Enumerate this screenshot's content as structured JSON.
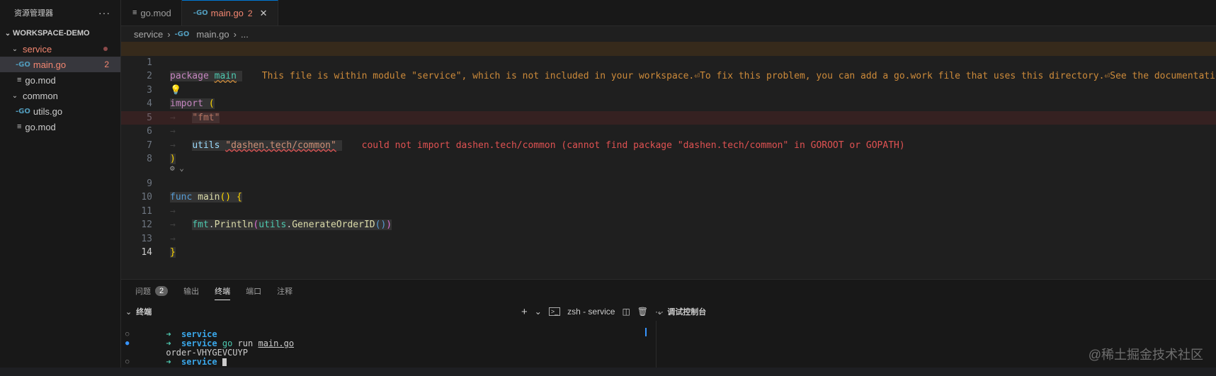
{
  "sidebar": {
    "title": "资源管理器",
    "more": "···",
    "workspace": "WORKSPACE-DEMO",
    "items": [
      {
        "label": "service",
        "type": "folder"
      },
      {
        "label": "main.go",
        "type": "go",
        "count": "2"
      },
      {
        "label": "go.mod",
        "type": "mod"
      },
      {
        "label": "common",
        "type": "folder"
      },
      {
        "label": "utils.go",
        "type": "go"
      },
      {
        "label": "go.mod",
        "type": "mod"
      }
    ]
  },
  "tabs": [
    {
      "label": "go.mod"
    },
    {
      "label": "main.go",
      "badge": "2"
    }
  ],
  "breadcrumb": {
    "folder": "service",
    "file": "main.go",
    "more": "..."
  },
  "warning_message": "This file is within module \"service\", which is not included in your workspace.⏎To fix this problem, you can add a go.work file that uses this directory.⏎See the documentatio",
  "error_message": "could not import dashen.tech/common (cannot find package \"dashen.tech/common\" in GOROOT or GOPATH)",
  "code": {
    "package_kw": "package",
    "package_name": "main",
    "import_kw": "import",
    "fmt_str": "\"fmt\"",
    "utils_alias": "utils",
    "common_str": "\"dashen.tech/common\"",
    "func_kw": "func",
    "main_fn": "main",
    "fmt_pkg": "fmt",
    "println_fn": "Println",
    "utils_pkg": "utils",
    "gen_fn": "GenerateOrderID"
  },
  "line_numbers": [
    "1",
    "2",
    "3",
    "4",
    "5",
    "6",
    "7",
    "8",
    "9",
    "10",
    "11",
    "12",
    "13",
    "14"
  ],
  "panel": {
    "tabs": [
      {
        "label": "问题",
        "badge": "2"
      },
      {
        "label": "输出"
      },
      {
        "label": "终端"
      },
      {
        "label": "端口"
      },
      {
        "label": "注释"
      }
    ],
    "terminal_title": "终端",
    "shell": "zsh - service",
    "debug_title": "调试控制台"
  },
  "terminal": {
    "arrow": "➜",
    "dir": "service",
    "cmd_go": "go",
    "cmd_run": "run",
    "cmd_file": "main.go",
    "output": "order-VHYGEVCUYP"
  },
  "watermark": "@稀土掘金技术社区"
}
